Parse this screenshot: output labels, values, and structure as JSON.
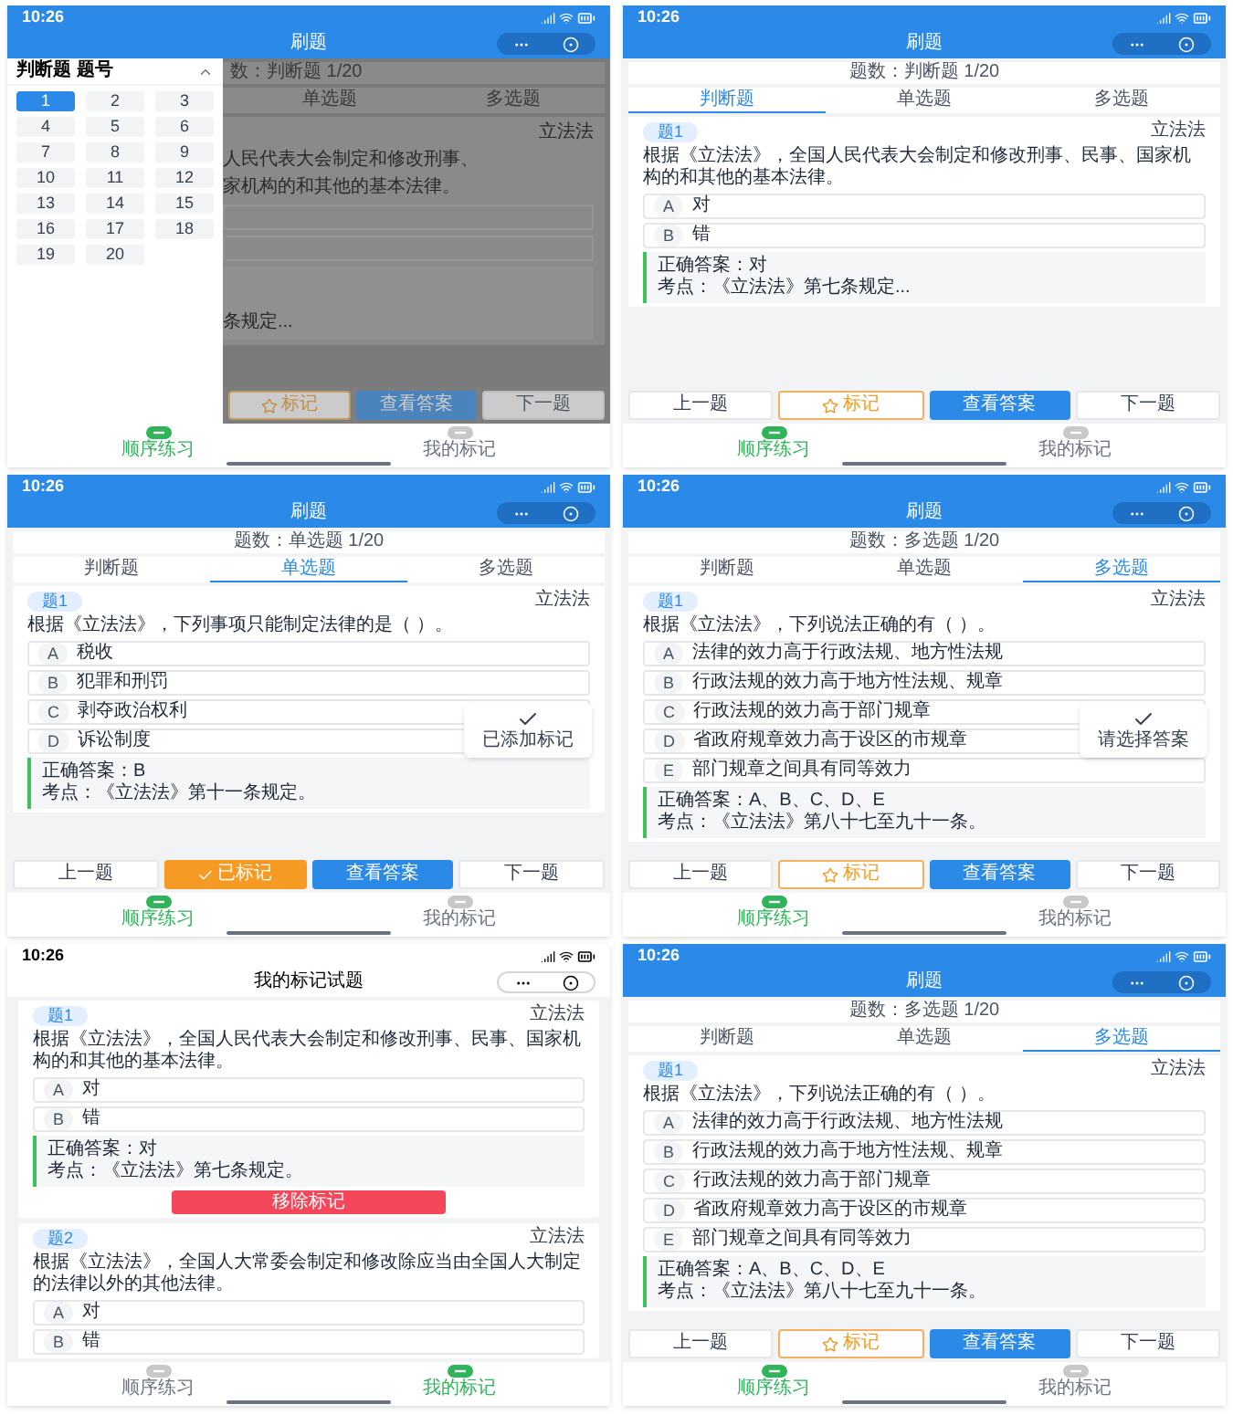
{
  "screens": [
    {
      "kind": "drawer",
      "time": "10:26",
      "title": "刷题",
      "drawer": {
        "title": "判断题 题号",
        "numbers": [
          {
            "label": "1",
            "selected": true
          },
          {
            "label": "2",
            "selected": false
          },
          {
            "label": "3",
            "selected": false
          },
          {
            "label": "4",
            "selected": false
          },
          {
            "label": "5",
            "selected": false
          },
          {
            "label": "6",
            "selected": false
          },
          {
            "label": "7",
            "selected": false
          },
          {
            "label": "8",
            "selected": false
          },
          {
            "label": "9",
            "selected": false
          },
          {
            "label": "10",
            "selected": false
          },
          {
            "label": "11",
            "selected": false
          },
          {
            "label": "12",
            "selected": false
          },
          {
            "label": "13",
            "selected": false
          },
          {
            "label": "14",
            "selected": false
          },
          {
            "label": "15",
            "selected": false
          },
          {
            "label": "16",
            "selected": false
          },
          {
            "label": "17",
            "selected": false
          },
          {
            "label": "18",
            "selected": false
          },
          {
            "label": "19",
            "selected": false
          },
          {
            "label": "20",
            "selected": false
          }
        ]
      },
      "count": "数：判断题 1/20",
      "tabs": [
        {
          "label": "单选题",
          "selected": false
        },
        {
          "label": "多选题",
          "selected": false
        }
      ],
      "subject": "立法法",
      "question_lines": [
        "人民代表大会制定和修改刑事、",
        "家机构的和其他的基本法律。"
      ],
      "answer_lines": [
        "条规定..."
      ],
      "actions": [
        {
          "kind": "mark",
          "label": "标记",
          "marked": false
        },
        {
          "kind": "answer",
          "label": "查看答案"
        },
        {
          "kind": "next",
          "label": "下一题"
        }
      ],
      "nav": [
        {
          "label": "顺序练习",
          "selected": true
        },
        {
          "label": "我的标记",
          "selected": false
        }
      ]
    },
    {
      "kind": "practice",
      "time": "10:26",
      "title": "刷题",
      "count": "题数：判断题 1/20",
      "tabs": [
        {
          "label": "判断题",
          "selected": true
        },
        {
          "label": "单选题",
          "selected": false
        },
        {
          "label": "多选题",
          "selected": false
        }
      ],
      "tag": "题1",
      "subject": "立法法",
      "question": "根据《立法法》，全国人民代表大会制定和修改刑事、民事、国家机构的和其他的基本法律。",
      "options": [
        {
          "letter": "A",
          "text": "对"
        },
        {
          "letter": "B",
          "text": "错"
        }
      ],
      "answer_lines": [
        "正确答案：对",
        "考点：《立法法》第七条规定..."
      ],
      "actions": [
        {
          "kind": "prev",
          "label": "上一题"
        },
        {
          "kind": "mark",
          "label": "标记",
          "marked": false
        },
        {
          "kind": "answer",
          "label": "查看答案"
        },
        {
          "kind": "next",
          "label": "下一题"
        }
      ],
      "nav": [
        {
          "label": "顺序练习",
          "selected": true
        },
        {
          "label": "我的标记",
          "selected": false
        }
      ]
    },
    {
      "kind": "practice",
      "time": "10:26",
      "title": "刷题",
      "count": "题数：单选题 1/20",
      "tabs": [
        {
          "label": "判断题",
          "selected": false
        },
        {
          "label": "单选题",
          "selected": true
        },
        {
          "label": "多选题",
          "selected": false
        }
      ],
      "tag": "题1",
      "subject": "立法法",
      "question": "根据《立法法》，下列事项只能制定法律的是（ ）。",
      "options": [
        {
          "letter": "A",
          "text": "税收"
        },
        {
          "letter": "B",
          "text": "犯罪和刑罚"
        },
        {
          "letter": "C",
          "text": "剥夺政治权利"
        },
        {
          "letter": "D",
          "text": "诉讼制度"
        }
      ],
      "toast": "已添加标记",
      "answer_lines": [
        "正确答案：B",
        "考点：《立法法》第十一条规定。"
      ],
      "actions": [
        {
          "kind": "prev",
          "label": "上一题"
        },
        {
          "kind": "mark",
          "label": "已标记",
          "marked": true
        },
        {
          "kind": "answer",
          "label": "查看答案"
        },
        {
          "kind": "next",
          "label": "下一题"
        }
      ],
      "nav": [
        {
          "label": "顺序练习",
          "selected": true
        },
        {
          "label": "我的标记",
          "selected": false
        }
      ]
    },
    {
      "kind": "practice",
      "time": "10:26",
      "title": "刷题",
      "count": "题数：多选题 1/20",
      "tabs": [
        {
          "label": "判断题",
          "selected": false
        },
        {
          "label": "单选题",
          "selected": false
        },
        {
          "label": "多选题",
          "selected": true
        }
      ],
      "tag": "题1",
      "subject": "立法法",
      "question": "根据《立法法》，下列说法正确的有（ ）。",
      "options": [
        {
          "letter": "A",
          "text": "法律的效力高于行政法规、地方性法规"
        },
        {
          "letter": "B",
          "text": "行政法规的效力高于地方性法规、规章"
        },
        {
          "letter": "C",
          "text": "行政法规的效力高于部门规章"
        },
        {
          "letter": "D",
          "text": "省政府规章效力高于设区的市规章"
        },
        {
          "letter": "E",
          "text": "部门规章之间具有同等效力"
        }
      ],
      "toast": "请选择答案",
      "answer_lines": [
        "正确答案：A、B、C、D、E",
        "考点：《立法法》第八十七至九十一条。"
      ],
      "actions": [
        {
          "kind": "prev",
          "label": "上一题"
        },
        {
          "kind": "mark",
          "label": "标记",
          "marked": false
        },
        {
          "kind": "answer",
          "label": "查看答案"
        },
        {
          "kind": "next",
          "label": "下一题"
        }
      ],
      "nav": [
        {
          "label": "顺序练习",
          "selected": true
        },
        {
          "label": "我的标记",
          "selected": false
        }
      ]
    },
    {
      "kind": "marked",
      "time": "10:26",
      "title": "我的标记试题",
      "cards": [
        {
          "tag": "题1",
          "subject": "立法法",
          "question": "根据《立法法》，全国人民代表大会制定和修改刑事、民事、国家机构的和其他的基本法律。",
          "options": [
            {
              "letter": "A",
              "text": "对"
            },
            {
              "letter": "B",
              "text": "错"
            }
          ],
          "answer_lines": [
            "正确答案：对",
            "考点：《立法法》第七条规定。"
          ],
          "remove": "移除标记"
        },
        {
          "tag": "题2",
          "subject": "立法法",
          "question": "根据《立法法》，全国人大常委会制定和修改除应当由全国人大制定的法律以外的其他法律。",
          "options": [
            {
              "letter": "A",
              "text": "对"
            },
            {
              "letter": "B",
              "text": "错"
            }
          ]
        }
      ],
      "nav": [
        {
          "label": "顺序练习",
          "selected": false
        },
        {
          "label": "我的标记",
          "selected": true
        }
      ]
    },
    {
      "kind": "practice",
      "time": "10:26",
      "title": "刷题",
      "count": "题数：多选题 1/20",
      "tabs": [
        {
          "label": "判断题",
          "selected": false
        },
        {
          "label": "单选题",
          "selected": false
        },
        {
          "label": "多选题",
          "selected": true
        }
      ],
      "tag": "题1",
      "subject": "立法法",
      "question": "根据《立法法》，下列说法正确的有（ ）。",
      "options": [
        {
          "letter": "A",
          "text": "法律的效力高于行政法规、地方性法规"
        },
        {
          "letter": "B",
          "text": "行政法规的效力高于地方性法规、规章"
        },
        {
          "letter": "C",
          "text": "行政法规的效力高于部门规章"
        },
        {
          "letter": "D",
          "text": "省政府规章效力高于设区的市规章"
        },
        {
          "letter": "E",
          "text": "部门规章之间具有同等效力"
        }
      ],
      "answer_lines": [
        "正确答案：A、B、C、D、E",
        "考点：《立法法》第八十七至九十一条。"
      ],
      "actions": [
        {
          "kind": "prev",
          "label": "上一题"
        },
        {
          "kind": "mark",
          "label": "标记",
          "marked": false
        },
        {
          "kind": "answer",
          "label": "查看答案"
        },
        {
          "kind": "next",
          "label": "下一题"
        }
      ],
      "nav": [
        {
          "label": "顺序练习",
          "selected": true
        },
        {
          "label": "我的标记",
          "selected": false
        }
      ]
    }
  ]
}
